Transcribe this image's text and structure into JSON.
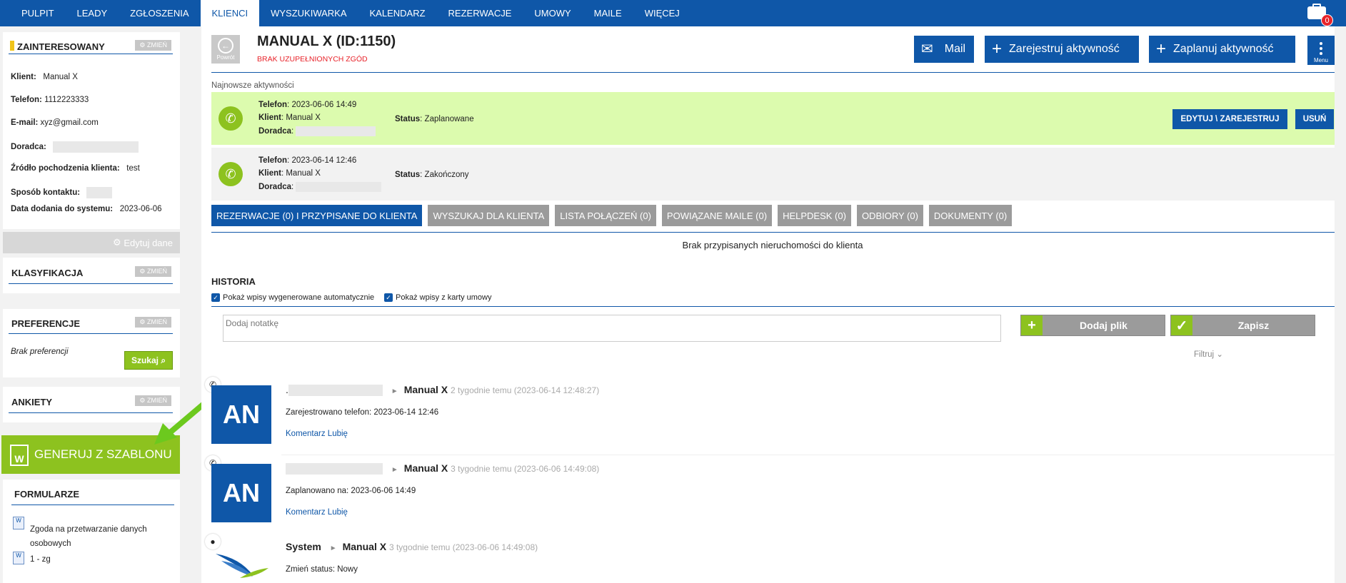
{
  "nav": {
    "items": [
      "PULPIT",
      "LEADY",
      "ZGŁOSZENIA",
      "KLIENCI",
      "WYSZUKIWARKA",
      "KALENDARZ",
      "REZERWACJE",
      "UMOWY",
      "MAILE",
      "WIĘCEJ"
    ],
    "active_index": 3,
    "notifications_count": "0"
  },
  "sidebar": {
    "status_title": "ZAINTERESOWANY",
    "change_label": "ZMIEŃ",
    "fields": {
      "klient_label": "Klient:",
      "klient_value": "Manual X",
      "telefon_label": "Telefon:",
      "telefon_value": "1112223333",
      "email_label": "E-mail:",
      "email_value": "xyz@gmail.com",
      "doradca_label": "Doradca:",
      "zrodlo_label": "Źródło pochodzenia klienta:",
      "zrodlo_value": "test",
      "sposob_label": "Sposób kontaktu:",
      "data_label": "Data dodania do systemu:",
      "data_value": "2023-06-06"
    },
    "edit_label": "Edytuj dane",
    "klasyfikacja_title": "KLASYFIKACJA",
    "preferencje_title": "PREFERENCJE",
    "brak_preferencji": "Brak preferencji",
    "szukaj_label": "Szukaj",
    "ankiety_title": "ANKIETY",
    "generuj_label": "GENERUJ Z SZABLONU",
    "formularze_title": "FORMULARZE",
    "formularze_items": [
      "Zgoda na przetwarzanie danych osobowych",
      "1 - zg"
    ]
  },
  "header": {
    "back_label": "Powrót",
    "title": "MANUAL X (ID:1150)",
    "subtitle": "BRAK UZUPEŁNIONYCH ZGÓD",
    "mail_label": "Mail",
    "zarejestruj_label": "Zarejestruj aktywność",
    "zaplanuj_label": "Zaplanuj aktywność",
    "menu_label": "Menu"
  },
  "activities": {
    "section_label": "Najnowsze aktywności",
    "items": [
      {
        "telefon_label": "Telefon",
        "telefon_value": "2023-06-06 14:49",
        "klient_label": "Klient",
        "klient_value": "Manual X",
        "doradca_label": "Doradca",
        "status_label": "Status",
        "status_value": "Zaplanowane"
      },
      {
        "telefon_label": "Telefon",
        "telefon_value": "2023-06-14 12:46",
        "klient_label": "Klient",
        "klient_value": "Manual X",
        "doradca_label": "Doradca",
        "status_label": "Status",
        "status_value": "Zakończony"
      }
    ],
    "edit_button": "EDYTUJ \\ ZAREJESTRUJ",
    "delete_button": "USUŃ"
  },
  "tabs": [
    "REZERWACJE (0) I PRZYPISANE DO KLIENTA",
    "WYSZUKAJ DLA KLIENTA",
    "LISTA POŁĄCZEŃ (0)",
    "POWIĄZANE MAILE (0)",
    "HELPDESK (0)",
    "ODBIORY (0)",
    "DOKUMENTY (0)"
  ],
  "no_properties_msg": "Brak przypisanych nieruchomości do klienta",
  "history": {
    "title": "HISTORIA",
    "check_auto": "Pokaż wpisy wygenerowane automatycznie",
    "check_umowy": "Pokaż wpisy z karty umowy",
    "note_placeholder": "Dodaj notatkę",
    "add_file_label": "Dodaj plik",
    "save_label": "Zapisz",
    "filter_label": "Filtruj",
    "entries": [
      {
        "avatar": "AN",
        "author_prefix": ".",
        "client": "Manual X",
        "time": "2 tygodnie temu (2023-06-14 12:48:27)",
        "body": "Zarejestrowano telefon: 2023-06-14 12:46",
        "links": "Komentarz Lubię"
      },
      {
        "avatar": "AN",
        "author_prefix": "",
        "client": "Manual X",
        "time": "3 tygodnie temu (2023-06-06 14:49:08)",
        "body": "Zaplanowano na: 2023-06-06 14:49",
        "links": "Komentarz Lubię"
      },
      {
        "avatar": "",
        "author_prefix": "System",
        "client": "Manual X",
        "time": "3 tygodnie temu (2023-06-06 14:49:08)",
        "body": "Zmień status: Nowy",
        "links": ""
      }
    ]
  }
}
